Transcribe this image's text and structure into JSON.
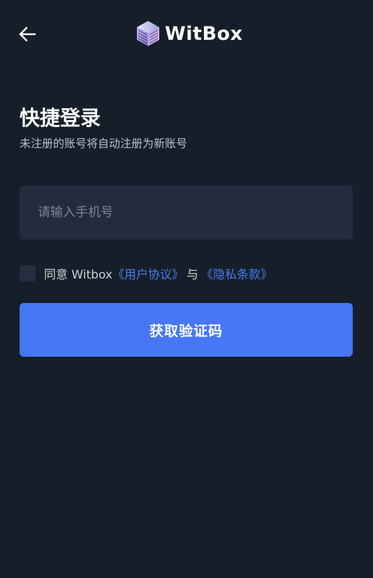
{
  "header": {
    "back_icon": "arrow-left-icon",
    "logo_icon": "witbox-cube-logo",
    "logo_text": "WitBox"
  },
  "login": {
    "title": "快捷登录",
    "subtitle": "未注册的账号将自动注册为新账号",
    "phone_value": "",
    "phone_placeholder": "请输入手机号",
    "agree_prefix": "同意 Witbox",
    "user_agreement_link": "《用户协议》",
    "conjunction": "与",
    "privacy_link": "《隐私条款》",
    "agree_checked": false,
    "submit_label": "获取验证码"
  },
  "colors": {
    "background": "#161f29",
    "input_bg": "#242b3f",
    "accent": "#4677f5",
    "link": "#4b7bf5"
  }
}
